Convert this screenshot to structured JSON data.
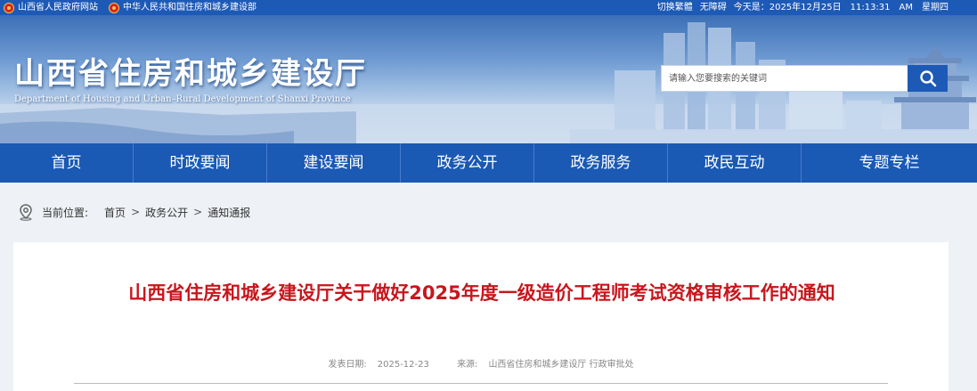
{
  "topbar": {
    "links": [
      {
        "label": "山西省人民政府网站",
        "icon": "national-emblem-icon"
      },
      {
        "label": "中华人民共和国住房和城乡建设部",
        "icon": "national-emblem-icon"
      }
    ],
    "switch_label": "切换繁體",
    "accessible_label": "无障碍",
    "date_text": "今天是：2025年12月25日　11:13:31　AM　星期四"
  },
  "header": {
    "title": "山西省住房和城乡建设厅",
    "subtitle": "Department of Housing and Urban–Rural Development of Shanxi Province",
    "search_placeholder": "请输入您要搜索的关键词",
    "search_icon": "search-icon"
  },
  "nav": {
    "items": [
      "首页",
      "时政要闻",
      "建设要闻",
      "政务公开",
      "政务服务",
      "政民互动",
      "专题专栏"
    ]
  },
  "breadcrumb": {
    "icon": "location-pin-icon",
    "label": "当前位置:",
    "items": [
      "首页",
      "政务公开",
      "通知通报"
    ],
    "separator": ">"
  },
  "article": {
    "title": "山西省住房和城乡建设厅关于做好2025年度一级造价工程师考试资格审核工作的通知",
    "date_label": "发表日期:",
    "date": "2025-12-23",
    "source_label": "来源:",
    "source": "山西省住房和城乡建设厅 行政审批处"
  },
  "colors": {
    "brand_blue": "#1a59b4",
    "title_red": "#c8161d"
  }
}
